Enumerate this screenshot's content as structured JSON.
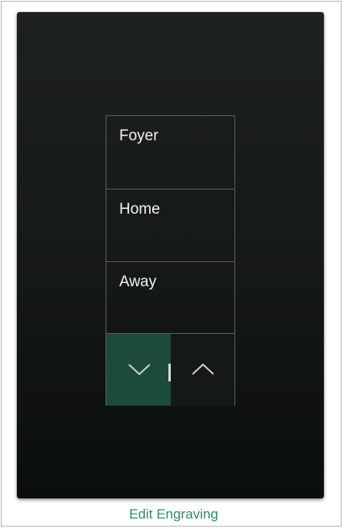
{
  "keypad": {
    "buttons": [
      {
        "label": "Foyer"
      },
      {
        "label": "Home"
      },
      {
        "label": "Away"
      }
    ],
    "raise_lower": {
      "lower_icon": "chevron-down-icon",
      "raise_icon": "chevron-up-icon",
      "selected": "lower",
      "selected_color": "#1c4a3c"
    }
  },
  "footer": {
    "edit_link_label": "Edit Engraving",
    "link_color": "#2e8b6e"
  }
}
